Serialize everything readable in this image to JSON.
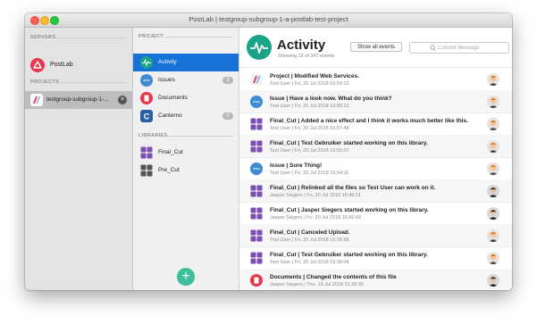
{
  "window": {
    "title": "PostLab | testgroup-subgroup-1-a-postlab-test-project"
  },
  "sidebar": {
    "servers_heading": "SERVERS",
    "server_name": "PostLab",
    "projects_heading": "PROJECTS",
    "project_name": "testgroup-subgroup-1-..."
  },
  "project_panel": {
    "project_heading": "PROJECT",
    "items": [
      {
        "label": "Activity",
        "icon": "activity-icon"
      },
      {
        "label": "Issues",
        "icon": "chat-bubble-icon",
        "badge": "3"
      },
      {
        "label": "Documents",
        "icon": "documents-icon"
      },
      {
        "label": "Canterno",
        "icon": "canterno-icon",
        "badge": "0"
      }
    ],
    "libraries_heading": "LIBRARIES",
    "libraries": [
      {
        "label": "Final_Cut",
        "icon": "final-cut-library-icon"
      },
      {
        "label": "Pre_Cut",
        "icon": "pre-cut-library-icon"
      }
    ],
    "add_button": "+"
  },
  "main": {
    "title": "Activity",
    "subtitle": "Showing 15 of 347 events",
    "show_all_label": "Show all events",
    "search_placeholder": "Commit Message",
    "events": [
      {
        "title": "Project | Modified Web Services.",
        "meta": "Test User | Fri, 20 Jul 2018 16:59:13",
        "icon": "project-icon",
        "avatar": "orange"
      },
      {
        "title": "Issue | Have a look now. What do you think?",
        "meta": "Test User | Fri, 20 Jul 2018 16:58:13",
        "icon": "issue-icon",
        "avatar": "orange"
      },
      {
        "title": "Final_Cut | Added a nice effect and I think it works much better like this.",
        "meta": "Test User | Fri, 20 Jul 2018 16:57:48",
        "icon": "library-icon",
        "avatar": "orange"
      },
      {
        "title": "Final_Cut | Test Gebruiker started working on this library.",
        "meta": "Test User | Fri, 20 Jul 2018 16:55:07",
        "icon": "library-icon",
        "avatar": "orange"
      },
      {
        "title": "Issue | Sure Thing!",
        "meta": "Test User | Fri, 20 Jul 2018 16:54:11",
        "icon": "issue-icon",
        "avatar": "orange"
      },
      {
        "title": "Final_Cut | Relinked all the files so Test User can work on it.",
        "meta": "Jasper Siegers | Fri, 20 Jul 2018 16:48:51",
        "icon": "library-icon",
        "avatar": "dark"
      },
      {
        "title": "Final_Cut | Jasper Siegers started working on this library.",
        "meta": "Jasper Siegers | Fri, 20 Jul 2018 16:42:43",
        "icon": "library-icon",
        "avatar": "dark"
      },
      {
        "title": "Final_Cut | Canceled Upload.",
        "meta": "Test User | Fri, 20 Jul 2018 16:38:58",
        "icon": "library-icon",
        "avatar": "orange"
      },
      {
        "title": "Final_Cut | Test Gebruiker started working on this library.",
        "meta": "Test User | Fri, 20 Jul 2018 16:38:04",
        "icon": "library-icon",
        "avatar": "orange"
      },
      {
        "title": "Documents | Changed the contents of this file",
        "meta": "Jasper Siegers | Thu, 19 Jul 2018 21:28:35",
        "icon": "documents-icon",
        "avatar": "dark"
      }
    ]
  },
  "colors": {
    "accent": "#1672d6",
    "postlab_brand": "#e8364e",
    "activity_green": "#1aa386",
    "issue_blue": "#3d8bd6",
    "library_purple": "#7b4fb3",
    "fab_green": "#3cbf9a"
  }
}
